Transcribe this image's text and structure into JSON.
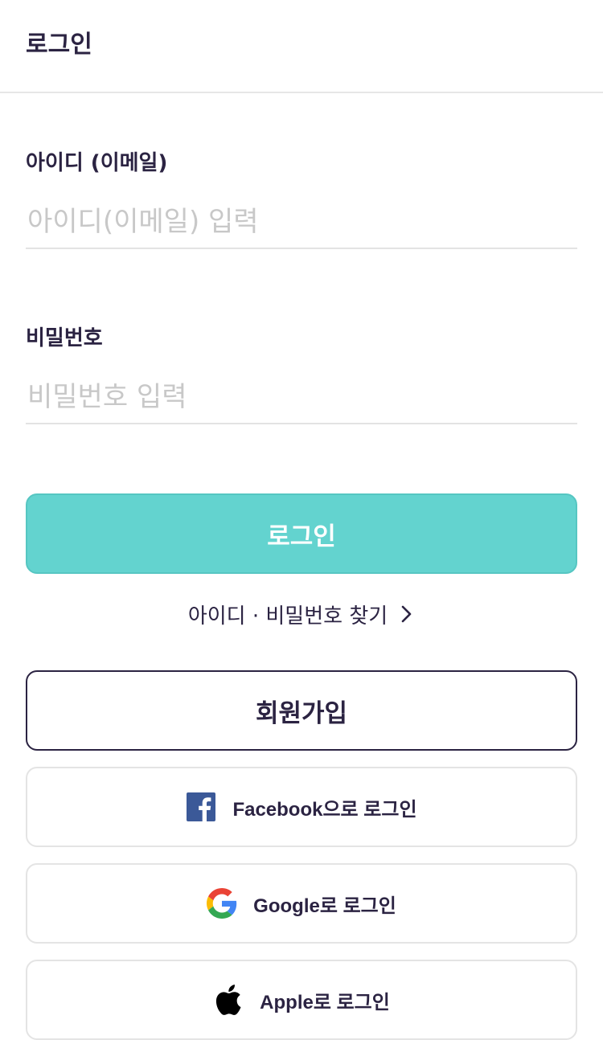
{
  "header": {
    "title": "로그인"
  },
  "form": {
    "id_label": "아이디 (이메일)",
    "id_placeholder": "아이디(이메일) 입력",
    "id_value": "",
    "password_label": "비밀번호",
    "password_placeholder": "비밀번호 입력",
    "password_value": ""
  },
  "actions": {
    "login_label": "로그인",
    "find_account_label": "아이디 · 비밀번호 찾기",
    "signup_label": "회원가입"
  },
  "social": {
    "facebook_label": "Facebook으로 로그인",
    "google_label": "Google로 로그인",
    "apple_label": "Apple로 로그인"
  },
  "icons": {
    "find_chevron": "chevron-right-icon",
    "facebook": "facebook-icon",
    "google": "google-icon",
    "apple": "apple-icon"
  },
  "colors": {
    "primary": "#63d3cf",
    "text": "#2b2342",
    "placeholder": "#c8c8c8",
    "facebook": "#3b5998"
  }
}
